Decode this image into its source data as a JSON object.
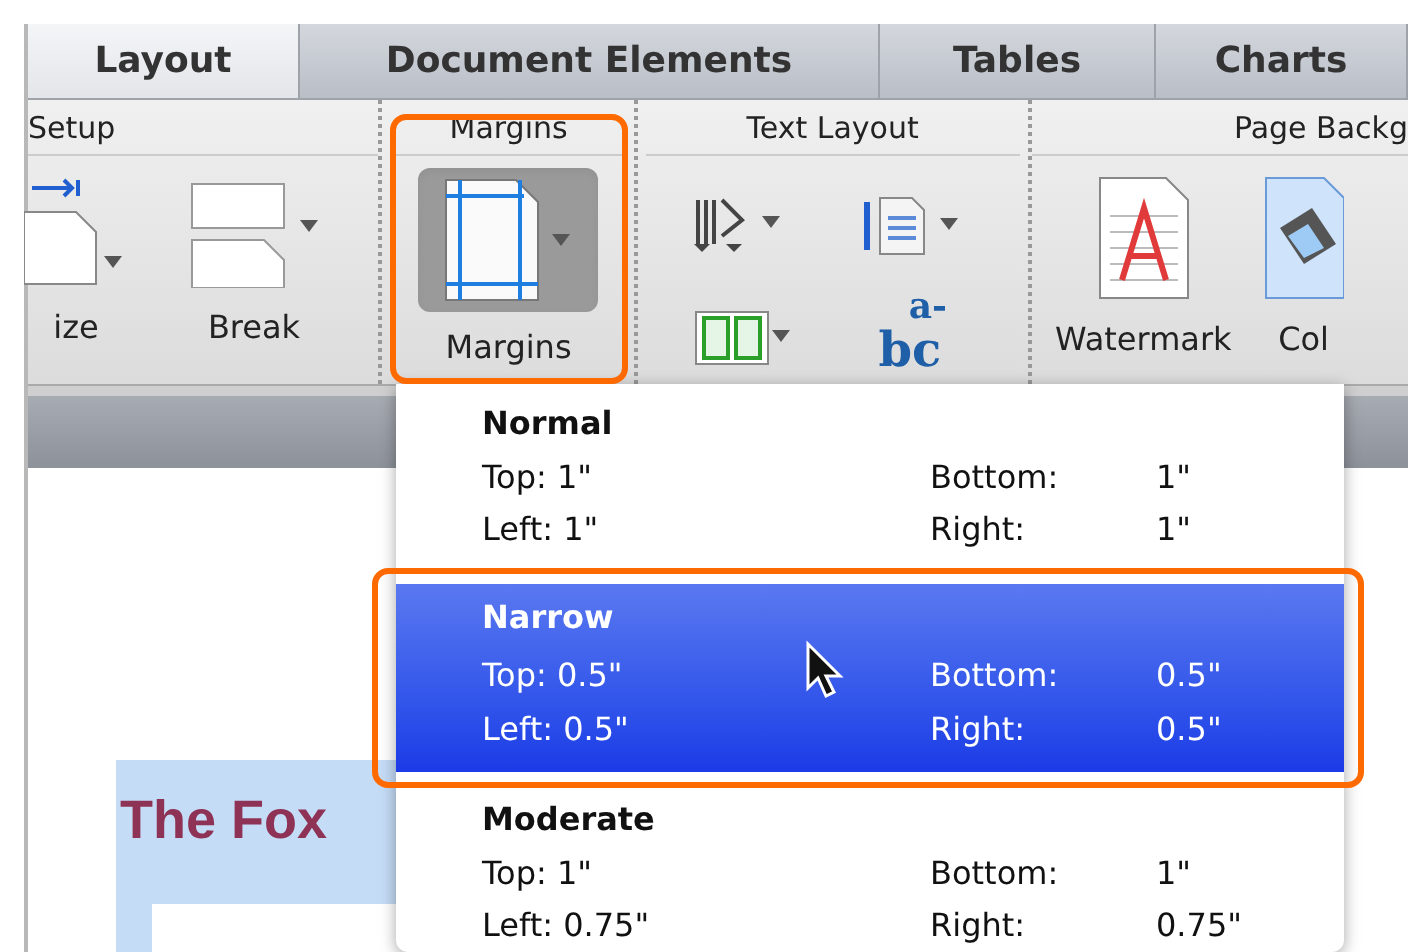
{
  "tabs": [
    {
      "label": "Layout",
      "selected": true
    },
    {
      "label": "Document Elements",
      "selected": false
    },
    {
      "label": "Tables",
      "selected": false
    },
    {
      "label": "Charts",
      "selected": false
    }
  ],
  "ribbon": {
    "groups": [
      {
        "kind": "setup",
        "label": "Setup",
        "buttons": [
          {
            "label": "ize"
          },
          {
            "label": "Break"
          }
        ]
      },
      {
        "kind": "margins",
        "label": "Margins",
        "buttons": [
          {
            "label": "Margins",
            "pressed": true
          }
        ]
      },
      {
        "kind": "text_layout",
        "label": "Text Layout",
        "hyphenation_glyphs": [
          "a-",
          "bc"
        ]
      },
      {
        "kind": "page_background",
        "label": "Page Backg",
        "buttons": [
          {
            "label": "Watermark"
          },
          {
            "label": "Col"
          }
        ]
      }
    ]
  },
  "margins_menu": {
    "items": [
      {
        "name": "Normal",
        "selected": false,
        "rows": [
          {
            "left_label": "Top:",
            "left_value": "1\"",
            "right_label": "Bottom:",
            "right_value": "1\""
          },
          {
            "left_label": "Left:",
            "left_value": "1\"",
            "right_label": "Right:",
            "right_value": "1\""
          }
        ]
      },
      {
        "name": "Narrow",
        "selected": true,
        "rows": [
          {
            "left_label": "Top:",
            "left_value": "0.5\"",
            "right_label": "Bottom:",
            "right_value": "0.5\""
          },
          {
            "left_label": "Left:",
            "left_value": "0.5\"",
            "right_label": "Right:",
            "right_value": "0.5\""
          }
        ]
      },
      {
        "name": "Moderate",
        "selected": false,
        "rows": [
          {
            "left_label": "Top:",
            "left_value": "1\"",
            "right_label": "Bottom:",
            "right_value": "1\""
          },
          {
            "left_label": "Left:",
            "left_value": "0.75\"",
            "right_label": "Right:",
            "right_value": "0.75\""
          }
        ]
      }
    ]
  },
  "document": {
    "heading": "The Fox"
  }
}
